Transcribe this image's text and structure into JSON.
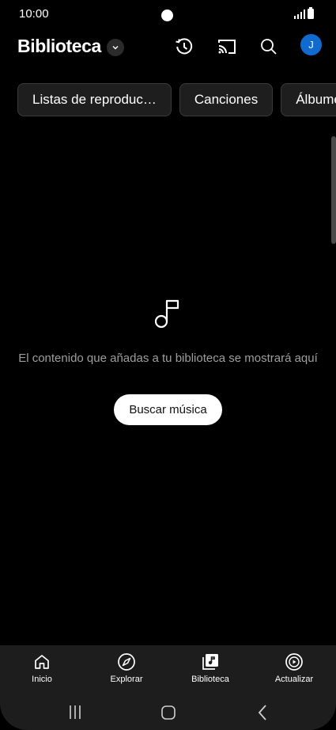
{
  "status_bar": {
    "time": "10:00"
  },
  "header": {
    "title": "Biblioteca",
    "avatar_initial": "J"
  },
  "chips": [
    {
      "label": "Listas de reproduc…"
    },
    {
      "label": "Canciones"
    },
    {
      "label": "Álbumes"
    }
  ],
  "empty_state": {
    "message": "El contenido que añadas a tu biblioteca se mostrará aquí",
    "button_label": "Buscar música"
  },
  "bottom_nav": [
    {
      "label": "Inicio",
      "icon": "home-icon"
    },
    {
      "label": "Explorar",
      "icon": "compass-icon"
    },
    {
      "label": "Biblioteca",
      "icon": "library-music-icon",
      "active": true
    },
    {
      "label": "Actualizar",
      "icon": "upgrade-play-icon"
    }
  ],
  "colors": {
    "background": "#000000",
    "surface": "#1d1d1d",
    "avatar": "#0f6bd0"
  }
}
